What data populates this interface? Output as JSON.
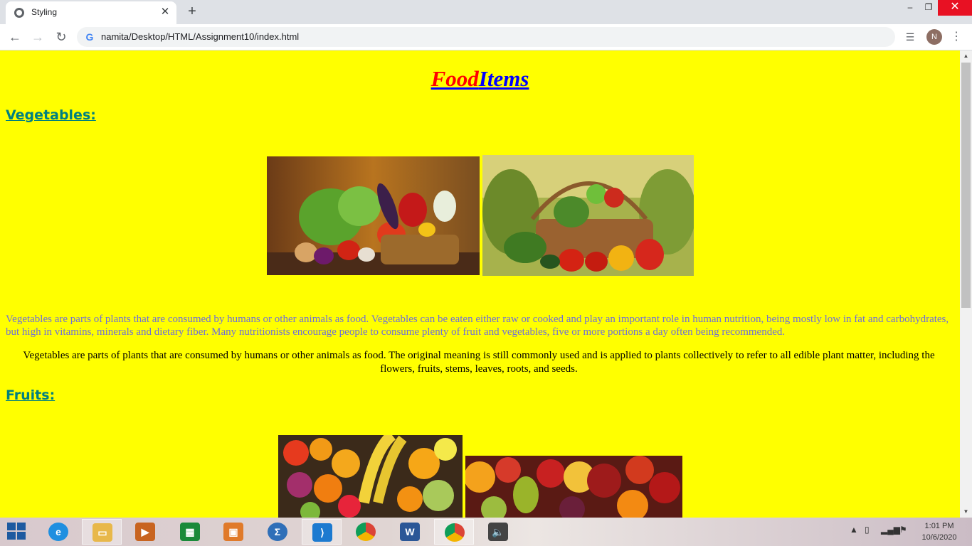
{
  "browser": {
    "tab_title": "Styling",
    "tab_close": "✕",
    "new_tab": "+",
    "url": "namita/Desktop/HTML/Assignment10/index.html",
    "window_minimize": "–",
    "window_restore": "❐",
    "window_close": "✕",
    "profile_initial": "N",
    "back_icon": "arrow-left-icon",
    "forward_icon": "arrow-right-icon",
    "reload_icon": "reload-icon"
  },
  "page": {
    "background": "#ffff00",
    "heading_part1": "Food",
    "heading_part2": "Items",
    "vegetables_title": "Vegetables:",
    "vegetables_para1": "Vegetables are parts of plants that are consumed by humans or other animals as food. Vegetables can be eaten either raw or cooked and play an important role in human nutrition, being mostly low in fat and carbohydrates, but high in vitamins, minerals and dietary fiber. Many nutritionists encourage people to consume plenty of fruit and vegetables, five or more portions a day often being recommended.",
    "vegetables_para2": "Vegetables are parts of plants that are consumed by humans or other animals as food. The original meaning is still commonly used and is applied to plants collectively to refer to all edible plant matter, including the flowers, fruits, stems, leaves, roots, and seeds.",
    "fruits_title": "Fruits:",
    "colors": {
      "heading_red": "#ff0000",
      "heading_blue": "#0000ff",
      "section_title": "#008080",
      "para_blue": "#6f6fd8"
    }
  },
  "taskbar": {
    "apps": [
      "internet-explorer",
      "file-explorer",
      "media-player",
      "store",
      "control-panel",
      "calculator",
      "vs-code",
      "chrome",
      "word",
      "chrome-profile",
      "speaker"
    ],
    "time": "1:01 PM",
    "date": "10/6/2020"
  }
}
